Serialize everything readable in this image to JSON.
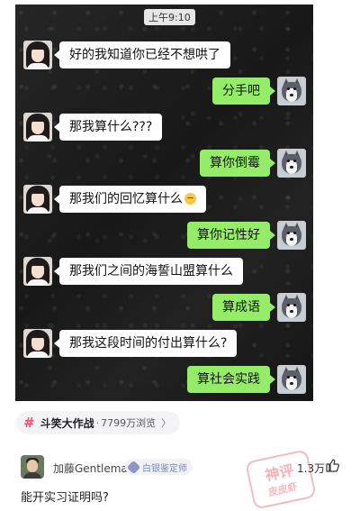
{
  "chat": {
    "time": "上午9:10",
    "messages": [
      {
        "side": "in",
        "text": "好的我知道你已经不想哄了"
      },
      {
        "side": "out",
        "text": "分手吧"
      },
      {
        "side": "in",
        "text": "那我算什么???"
      },
      {
        "side": "out",
        "text": "算你倒霉"
      },
      {
        "side": "in",
        "text": "那我们的回忆算什么",
        "emoji": "grimace-emoji"
      },
      {
        "side": "out",
        "text": "算你记性好"
      },
      {
        "side": "in",
        "text": "那我们之间的海誓山盟算什么"
      },
      {
        "side": "out",
        "text": "算成语"
      },
      {
        "side": "in",
        "text": "那我这段时间的付出算什么?"
      },
      {
        "side": "out",
        "text": "算社会实践"
      }
    ]
  },
  "topic": {
    "icon": "hashtag-icon",
    "name": "斗笑大作战",
    "separator": "·",
    "views": "7799万浏览",
    "chevron": "〉"
  },
  "comment": {
    "username": "加藤Gentleman",
    "badge": "白银鉴定师",
    "likes": "1.3万",
    "text": "能开实习证明吗?"
  },
  "watermark": {
    "line1": "神评",
    "line2": "皮皮虾"
  },
  "colors": {
    "incoming_bubble": "#ffffff",
    "outgoing_bubble": "#95ec69",
    "topic_accent": "#ff4d6d",
    "badge_text": "#7a86b4"
  }
}
